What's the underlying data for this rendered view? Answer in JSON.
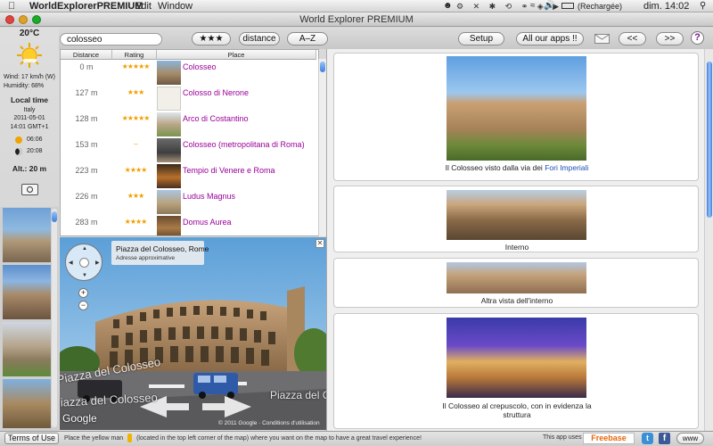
{
  "menubar": {
    "app_name": "WorldExplorerPREMIUM",
    "menus": [
      "Edit",
      "Window"
    ],
    "battery_status": "(Rechargée)",
    "datetime": "dim. 14:02"
  },
  "window": {
    "title": "World Explorer PREMIUM"
  },
  "toolbar": {
    "search_value": "colosseo",
    "sort_stars": "★★★",
    "sort_distance": "distance",
    "sort_az": "A–Z",
    "setup": "Setup",
    "all_apps": "All our apps !!",
    "prev": "<<",
    "next": ">>",
    "help": "?"
  },
  "weather": {
    "temperature": "20°C",
    "wind": "Wind: 17 km/h (W)",
    "humidity": "Humidity: 68%",
    "local_time_label": "Local time",
    "country": "Italy",
    "date": "2011-05-01",
    "time": "14:01 GMT+1",
    "sunrise": "06:06",
    "sunset": "20:08",
    "altitude": "Alt.: 20 m"
  },
  "list": {
    "headers": [
      "Distance",
      "Rating",
      "Place"
    ],
    "rows": [
      {
        "distance": "0 m",
        "rating": "★★★★★",
        "name": "Colosseo"
      },
      {
        "distance": "127 m",
        "rating": "★★★",
        "name": "Colosso di Nerone"
      },
      {
        "distance": "128 m",
        "rating": "★★★★★",
        "name": "Arco di Costantino"
      },
      {
        "distance": "153 m",
        "rating": "–",
        "name": "Colosseo (metropolitana di Roma)"
      },
      {
        "distance": "223 m",
        "rating": "★★★★",
        "name": "Tempio di Venere e Roma"
      },
      {
        "distance": "226 m",
        "rating": "★★★",
        "name": "Ludus Magnus"
      },
      {
        "distance": "283 m",
        "rating": "★★★★",
        "name": "Domus Aurea"
      }
    ]
  },
  "map": {
    "address": "Piazza del Colosseo, Rome",
    "address_note": "Adresse approximative",
    "street_label_1": "Piazza del Colosseo",
    "street_label_2": "Piazza del Colosseo",
    "street_label_3": "Piazza del Colosseo",
    "copyright": "© 2011 Google · Conditions d'utilisation",
    "logo": "Google"
  },
  "gallery": {
    "captions": [
      {
        "text": "Il Colosseo visto dalla via dei ",
        "link": "Fori Imperiali"
      },
      {
        "text": "Interno"
      },
      {
        "text": "Altra vista dell'interno"
      },
      {
        "text": "Il Colosseo al crepuscolo, con in evidenza la struttura"
      }
    ]
  },
  "bottom": {
    "terms": "Terms of Use",
    "hint_before": "Place the yellow man",
    "hint_after": "(located in the top left corner of the map) where you want on the map to have a great travel experience!",
    "app_uses": "This app uses",
    "freebase": "Freebase",
    "www": "www"
  },
  "colors": {
    "accent_link": "#990099",
    "stars": "#f0a000",
    "link_blue": "#1a4fb3"
  }
}
